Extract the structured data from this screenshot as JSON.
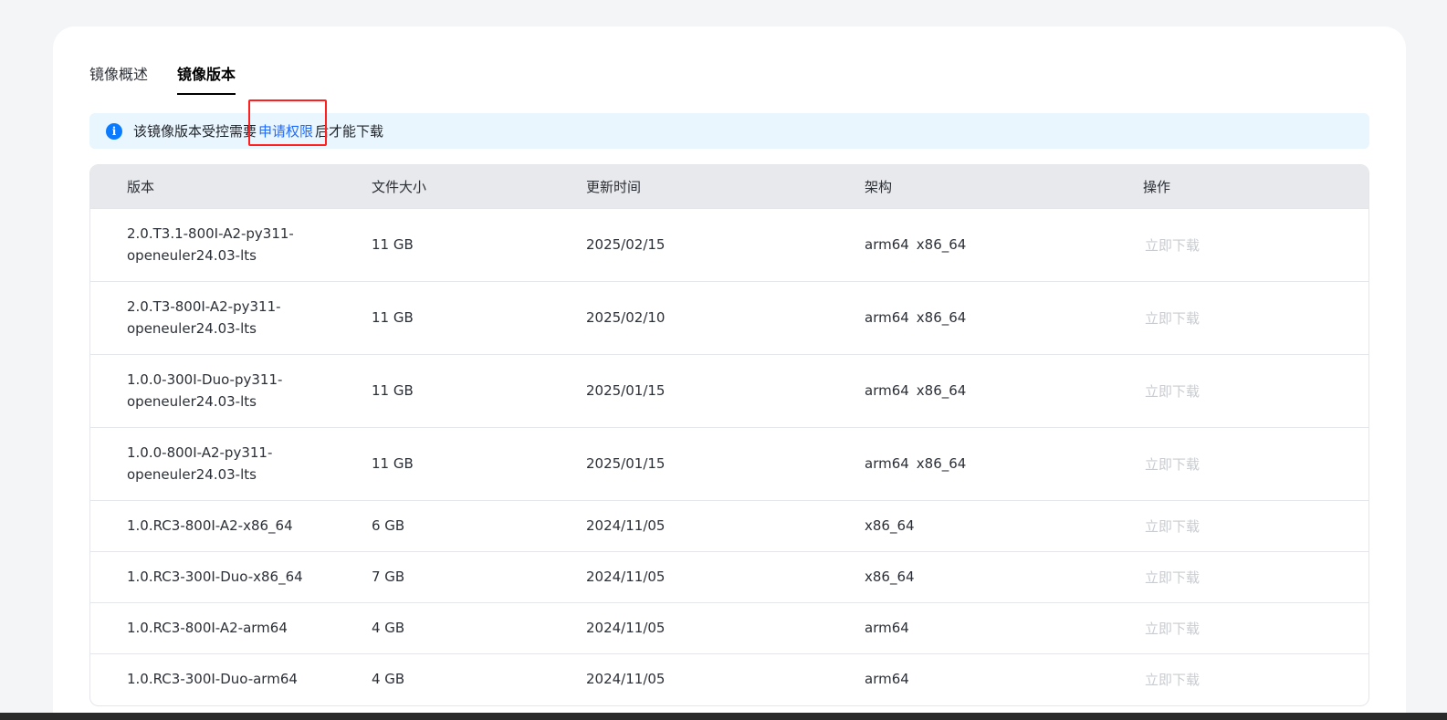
{
  "tabs": [
    {
      "label": "镜像概述",
      "active": false
    },
    {
      "label": "镜像版本",
      "active": true
    }
  ],
  "notice": {
    "icon": "info-icon",
    "prefix": "该镜像版本受控需要",
    "link": "申请权限",
    "suffix": "后才能下载"
  },
  "table": {
    "headers": [
      "版本",
      "文件大小",
      "更新时间",
      "架构",
      "操作"
    ],
    "rows": [
      {
        "version": "2.0.T3.1-800I-A2-py311-openeuler24.03-lts",
        "size": "11 GB",
        "date": "2025/02/15",
        "arch": [
          "arm64",
          "x86_64"
        ],
        "action": "立即下载"
      },
      {
        "version": "2.0.T3-800I-A2-py311-openeuler24.03-lts",
        "size": "11 GB",
        "date": "2025/02/10",
        "arch": [
          "arm64",
          "x86_64"
        ],
        "action": "立即下载"
      },
      {
        "version": "1.0.0-300I-Duo-py311-openeuler24.03-lts",
        "size": "11 GB",
        "date": "2025/01/15",
        "arch": [
          "arm64",
          "x86_64"
        ],
        "action": "立即下载"
      },
      {
        "version": "1.0.0-800I-A2-py311-openeuler24.03-lts",
        "size": "11 GB",
        "date": "2025/01/15",
        "arch": [
          "arm64",
          "x86_64"
        ],
        "action": "立即下载"
      },
      {
        "version": "1.0.RC3-800I-A2-x86_64",
        "size": "6 GB",
        "date": "2024/11/05",
        "arch": [
          "x86_64"
        ],
        "action": "立即下载"
      },
      {
        "version": "1.0.RC3-300I-Duo-x86_64",
        "size": "7 GB",
        "date": "2024/11/05",
        "arch": [
          "x86_64"
        ],
        "action": "立即下载"
      },
      {
        "version": "1.0.RC3-800I-A2-arm64",
        "size": "4 GB",
        "date": "2024/11/05",
        "arch": [
          "arm64"
        ],
        "action": "立即下载"
      },
      {
        "version": "1.0.RC3-300I-Duo-arm64",
        "size": "4 GB",
        "date": "2024/11/05",
        "arch": [
          "arm64"
        ],
        "action": "立即下载"
      }
    ]
  },
  "colors": {
    "link": "#1f6bff",
    "highlight": "#ff1f1f",
    "notice_bg": "#e9f6fe",
    "disabled": "#c9ccd1"
  }
}
